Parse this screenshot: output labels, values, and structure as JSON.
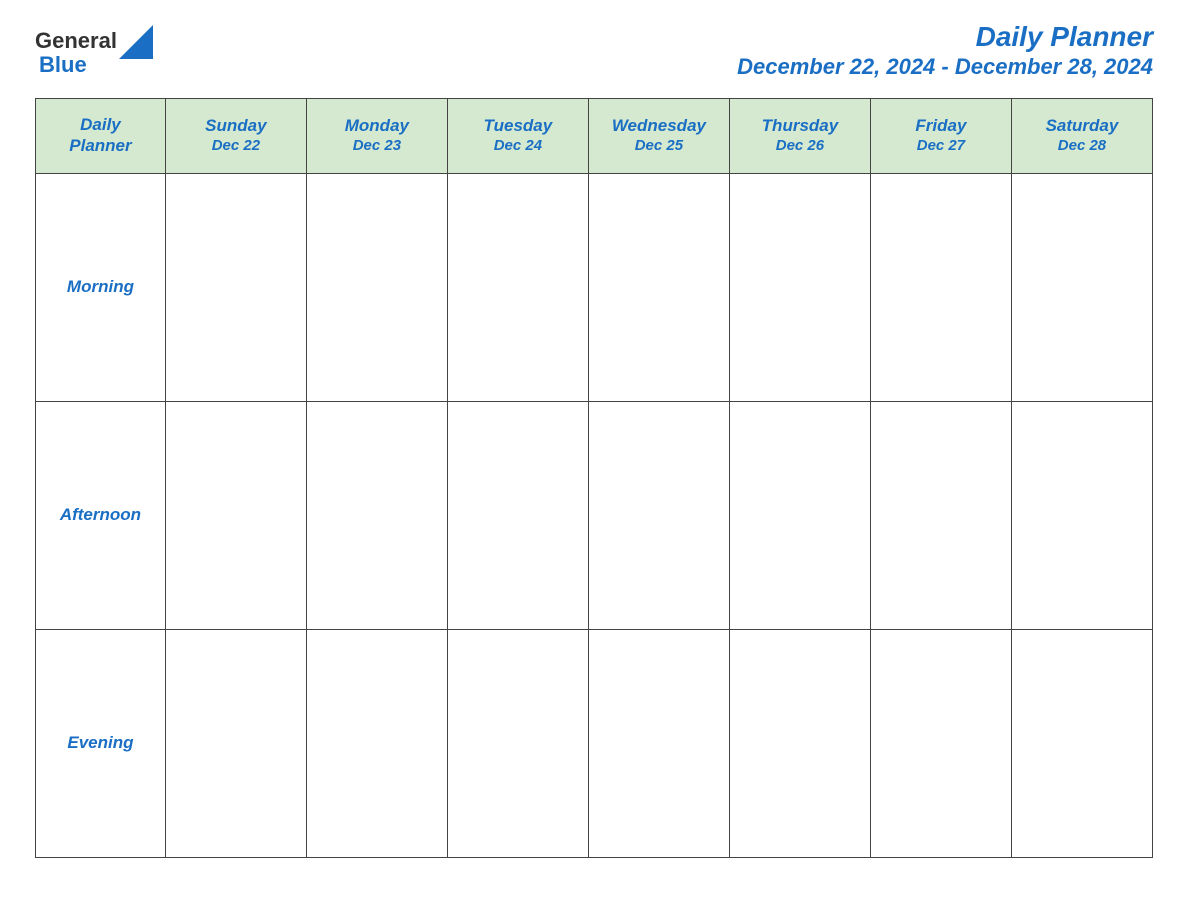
{
  "header": {
    "logo_text_general": "General",
    "logo_text_blue": "Blue",
    "main_title": "Daily Planner",
    "date_range": "December 22, 2024 - December 28, 2024"
  },
  "table": {
    "label_col": {
      "header_line1": "Daily",
      "header_line2": "Planner"
    },
    "days": [
      {
        "name": "Sunday",
        "date": "Dec 22"
      },
      {
        "name": "Monday",
        "date": "Dec 23"
      },
      {
        "name": "Tuesday",
        "date": "Dec 24"
      },
      {
        "name": "Wednesday",
        "date": "Dec 25"
      },
      {
        "name": "Thursday",
        "date": "Dec 26"
      },
      {
        "name": "Friday",
        "date": "Dec 27"
      },
      {
        "name": "Saturday",
        "date": "Dec 28"
      }
    ],
    "rows": [
      {
        "label": "Morning"
      },
      {
        "label": "Afternoon"
      },
      {
        "label": "Evening"
      }
    ]
  }
}
